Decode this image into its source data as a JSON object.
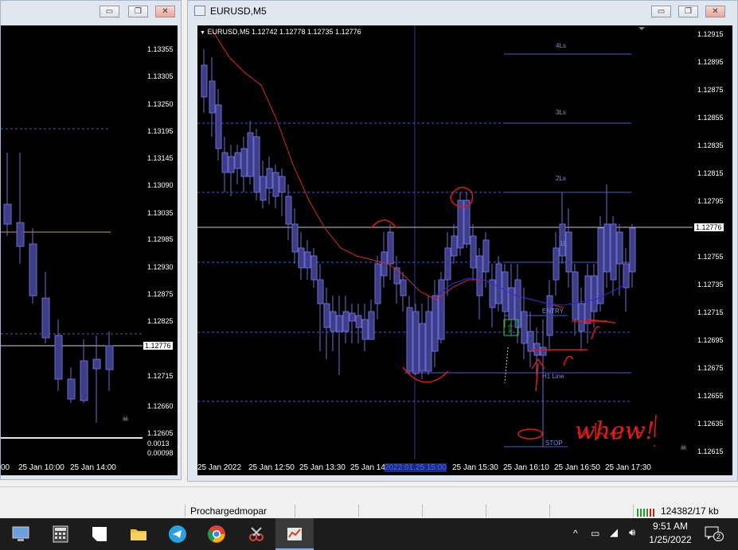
{
  "left_window": {
    "price_labels": [
      "1.13355",
      "1.13305",
      "1.13250",
      "1.13195",
      "1.13145",
      "1.13090",
      "1.13035",
      "1.12985",
      "1.12930",
      "1.12875",
      "1.12825",
      "1.12776",
      "1.12715",
      "1.12660",
      "1.12605"
    ],
    "current_price": "1.12776",
    "indicator_values": [
      "0.0013",
      "0.00098"
    ],
    "time_labels": [
      "00",
      "25 Jan 10:00",
      "25 Jan 14:00"
    ]
  },
  "right_window": {
    "title": "EURUSD,M5",
    "chart_header": "EURUSD,M5  1.12742 1.12778 1.12735 1.12776",
    "price_labels": [
      "1.12915",
      "1.12895",
      "1.12875",
      "1.12855",
      "1.12835",
      "1.12815",
      "1.12795",
      "1.12776",
      "1.12755",
      "1.12735",
      "1.12715",
      "1.12695",
      "1.12675",
      "1.12655",
      "1.12635",
      "1.12615"
    ],
    "current_price": "1.12776",
    "time_labels": [
      "25 Jan 2022",
      "25 Jan 12:50",
      "25 Jan 13:30",
      "25 Jan 14:",
      "2022.01.25 15:00",
      "25 Jan 15:30",
      "25 Jan 16:10",
      "25 Jan 16:50",
      "25 Jan 17:30"
    ],
    "level_labels": {
      "l4": "4Ls",
      "l3": "3Ls",
      "l2": "2Ls",
      "l1": "1L",
      "entry": "ENTRY",
      "h1": "H1 Line",
      "stop": "STOP"
    },
    "annotation": "whew!"
  },
  "status_bar": {
    "profile": "Prochargedmopar",
    "traffic": "124382/17 kb"
  },
  "taskbar": {
    "time": "9:51 AM",
    "date": "1/25/2022",
    "notification_count": "2"
  },
  "colors": {
    "chart_bg": "#000000",
    "candle": "#3d3d8a",
    "ma_red": "#d42a2a",
    "ma_blue": "#2a2ad8",
    "level_line": "#4a5ad0",
    "annotation": "#e01818"
  }
}
